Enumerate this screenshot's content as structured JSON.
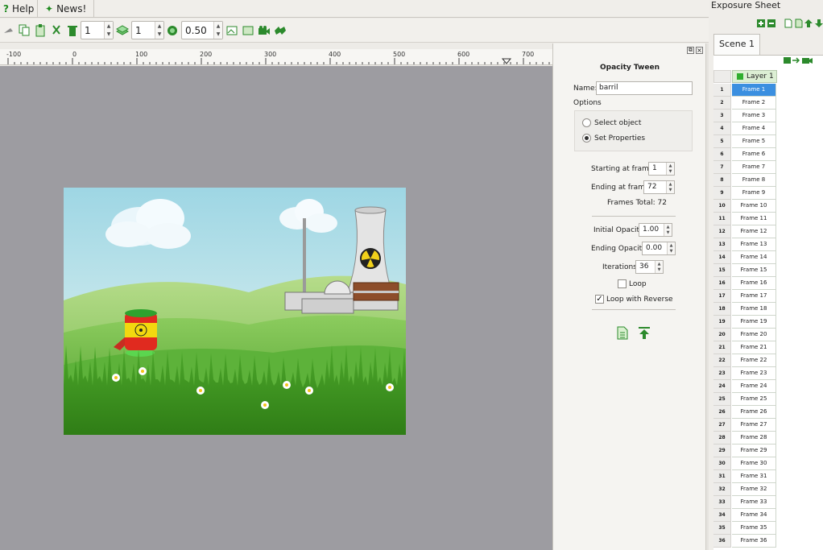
{
  "menu": {
    "help_label": "Help",
    "news_label": "News!"
  },
  "toolbar": {
    "frames_value": "1",
    "layers_value": "1",
    "opacity_value": "0.50"
  },
  "ruler": {
    "labels": [
      "-100",
      "0",
      "100",
      "200",
      "300",
      "400",
      "500",
      "600",
      "700"
    ]
  },
  "tween": {
    "title": "Opacity Tween",
    "name_label": "Name:",
    "name_value": "barril",
    "options_label": "Options",
    "select_object_label": "Select object",
    "set_properties_label": "Set Properties",
    "starting_frame_label": "Starting at frame:",
    "starting_frame_value": "1",
    "ending_frame_label": "Ending at frame:",
    "ending_frame_value": "72",
    "frames_total_label": "Frames Total: 72",
    "initial_opacity_label": "Initial Opacity:",
    "initial_opacity_value": "1.00",
    "ending_opacity_label": "Ending Opacity:",
    "ending_opacity_value": "0.00",
    "iterations_label": "Iterations:",
    "iterations_value": "36",
    "loop_label": "Loop",
    "loop_checked": false,
    "loop_reverse_label": "Loop with Reverse",
    "loop_reverse_checked": true
  },
  "exposure": {
    "title": "Exposure Sheet",
    "scene_tab": "Scene 1",
    "layer_name": "Layer 1",
    "selected_frame": 1,
    "frames": [
      "Frame 1",
      "Frame 2",
      "Frame 3",
      "Frame 4",
      "Frame 5",
      "Frame 6",
      "Frame 7",
      "Frame 8",
      "Frame 9",
      "Frame 10",
      "Frame 11",
      "Frame 12",
      "Frame 13",
      "Frame 14",
      "Frame 15",
      "Frame 16",
      "Frame 17",
      "Frame 18",
      "Frame 19",
      "Frame 20",
      "Frame 21",
      "Frame 22",
      "Frame 23",
      "Frame 24",
      "Frame 25",
      "Frame 26",
      "Frame 27",
      "Frame 28",
      "Frame 29",
      "Frame 30",
      "Frame 31",
      "Frame 32",
      "Frame 33",
      "Frame 34",
      "Frame 35",
      "Frame 36"
    ]
  },
  "colors": {
    "accent_green": "#1f8a1f",
    "selection_blue": "#3b8fe0",
    "canvas_gray": "#9d9ca1"
  }
}
